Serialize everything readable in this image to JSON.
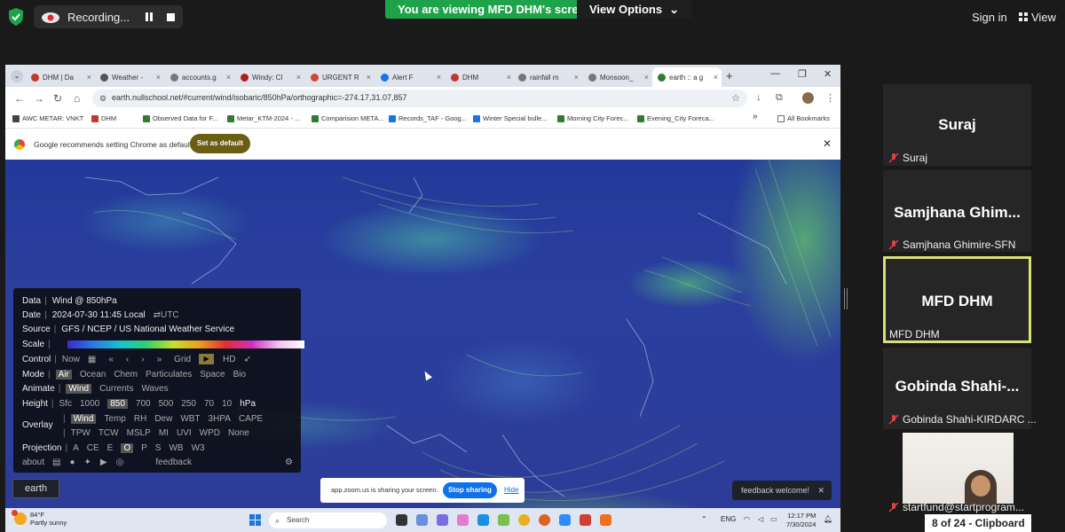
{
  "zoom": {
    "recording_label": "Recording...",
    "banner": "You are viewing MFD DHM's screen",
    "view_options": "View Options",
    "view_options_arrow": "⌄",
    "sign_in": "Sign in",
    "view": "View"
  },
  "browser": {
    "tabs": [
      {
        "label": "DHM | Da",
        "color": "#c0392b"
      },
      {
        "label": "Weather -",
        "color": "#555555"
      },
      {
        "label": "accounts.g",
        "color": "#777777"
      },
      {
        "label": "Windy: Cl",
        "color": "#b71c1c"
      },
      {
        "label": "URGENT R",
        "color": "#d44638"
      },
      {
        "label": "Alert F",
        "color": "#1a73e8"
      },
      {
        "label": "DHM",
        "color": "#c0392b"
      },
      {
        "label": "rainfall m",
        "color": "#777777"
      },
      {
        "label": "Monsoon_",
        "color": "#777777"
      },
      {
        "label": "earth :: a g",
        "color": "#2e7d32"
      }
    ],
    "url": "earth.nullschool.net/#current/wind/isobaric/850hPa/orthographic=-274.17,31.07,857",
    "bookmarks": [
      {
        "label": "AWC METAR: VNKT",
        "color": "#444444"
      },
      {
        "label": "DHM",
        "color": "#c0392b"
      },
      {
        "label": "Observed Data for F...",
        "color": "#2e7d32"
      },
      {
        "label": "Metar_KTM-2024 - ...",
        "color": "#2e7d32"
      },
      {
        "label": "Comparision META...",
        "color": "#2e7d32"
      },
      {
        "label": "Records_TAF - Goog...",
        "color": "#1a73e8"
      },
      {
        "label": "Winter Special bulle...",
        "color": "#1a73e8"
      },
      {
        "label": "Morning City Forec...",
        "color": "#2e7d32"
      },
      {
        "label": "Evening_City Foreca...",
        "color": "#2e7d32"
      }
    ],
    "bookmarks_more": "»",
    "all_bookmarks": "All Bookmarks",
    "infobar_text": "Google recommends setting Chrome as default",
    "set_default": "Set as default"
  },
  "earth": {
    "data_label": "Data",
    "data_value": "Wind @ 850hPa",
    "date_label": "Date",
    "date_value": "2024-07-30 11:45 Local",
    "date_toggle": "⇄UTC",
    "source_label": "Source",
    "source_value": "GFS / NCEP / US National Weather Service",
    "scale_label": "Scale",
    "control_label": "Control",
    "control_now": "Now",
    "control_grid": "Grid",
    "control_hd": "HD",
    "mode_label": "Mode",
    "modes": [
      "Air",
      "Ocean",
      "Chem",
      "Particulates",
      "Space",
      "Bio"
    ],
    "animate_label": "Animate",
    "animates": [
      "Wind",
      "Currents",
      "Waves"
    ],
    "height_label": "Height",
    "heights": [
      "Sfc",
      "1000",
      "850",
      "700",
      "500",
      "250",
      "70",
      "10",
      "hPa"
    ],
    "overlay_label": "Overlay",
    "overlays_row1": [
      "Wind",
      "Temp",
      "RH",
      "Dew",
      "WBT",
      "3HPA",
      "CAPE"
    ],
    "overlays_row2": [
      "TPW",
      "TCW",
      "MSLP",
      "MI",
      "UVI",
      "WPD",
      "None"
    ],
    "projection_label": "Projection",
    "projections": [
      "A",
      "CE",
      "E",
      "O",
      "P",
      "S",
      "WB",
      "W3"
    ],
    "about": "about",
    "feedback": "feedback",
    "earth_label": "earth",
    "feedback_welcome": "feedback welcome!"
  },
  "share": {
    "text": "app.zoom.us is sharing your screen.",
    "stop": "Stop sharing",
    "hide": "Hide"
  },
  "taskbar": {
    "temp": "84°F",
    "condition": "Partly sunny",
    "search": "Search",
    "lang": "ENG",
    "time": "12:17 PM",
    "date": "7/30/2024"
  },
  "participants": [
    {
      "big": "Suraj",
      "small": "Suraj"
    },
    {
      "big": "Samjhana  Ghim...",
      "small": "Samjhana Ghimire-SFN"
    },
    {
      "big": "MFD DHM",
      "small": "MFD DHM"
    },
    {
      "big": "Gobinda  Shahi-...",
      "small": "Gobinda Shahi-KIRDARC ..."
    }
  ],
  "webcam_name": "startfund@startprogram...",
  "clipboard": "8 of 24 - Clipboard"
}
